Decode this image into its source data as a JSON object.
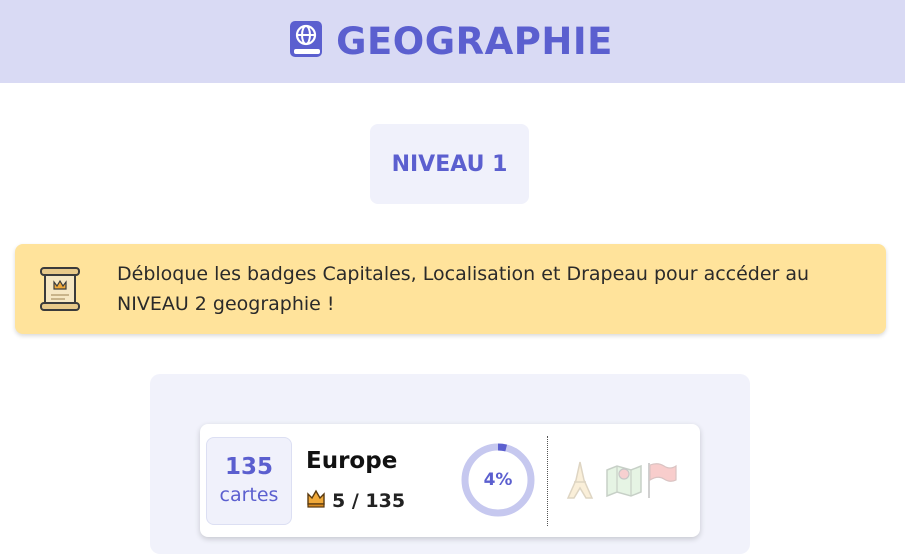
{
  "header": {
    "title": "GEOGRAPHIE",
    "icon": "globe-book-icon"
  },
  "level": {
    "label": "NIVEAU 1"
  },
  "notice": {
    "text": "Débloque les badges Capitales, Localisation et Drapeau pour accéder au NIVEAU 2 geographie !",
    "icon": "scroll-icon"
  },
  "deck": {
    "count": "135",
    "count_label": "cartes",
    "name": "Europe",
    "crown_progress": "5 / 135",
    "percent_label": "4%",
    "percent_value": 4,
    "badges": [
      "tower-icon",
      "map-icon",
      "flag-icon"
    ]
  },
  "colors": {
    "accent": "#5b5fcf",
    "header_bg": "#d9daf4",
    "notice_bg": "#ffe39b",
    "panel_bg": "#f1f2fb",
    "ring_bg": "#c6c8ef"
  }
}
